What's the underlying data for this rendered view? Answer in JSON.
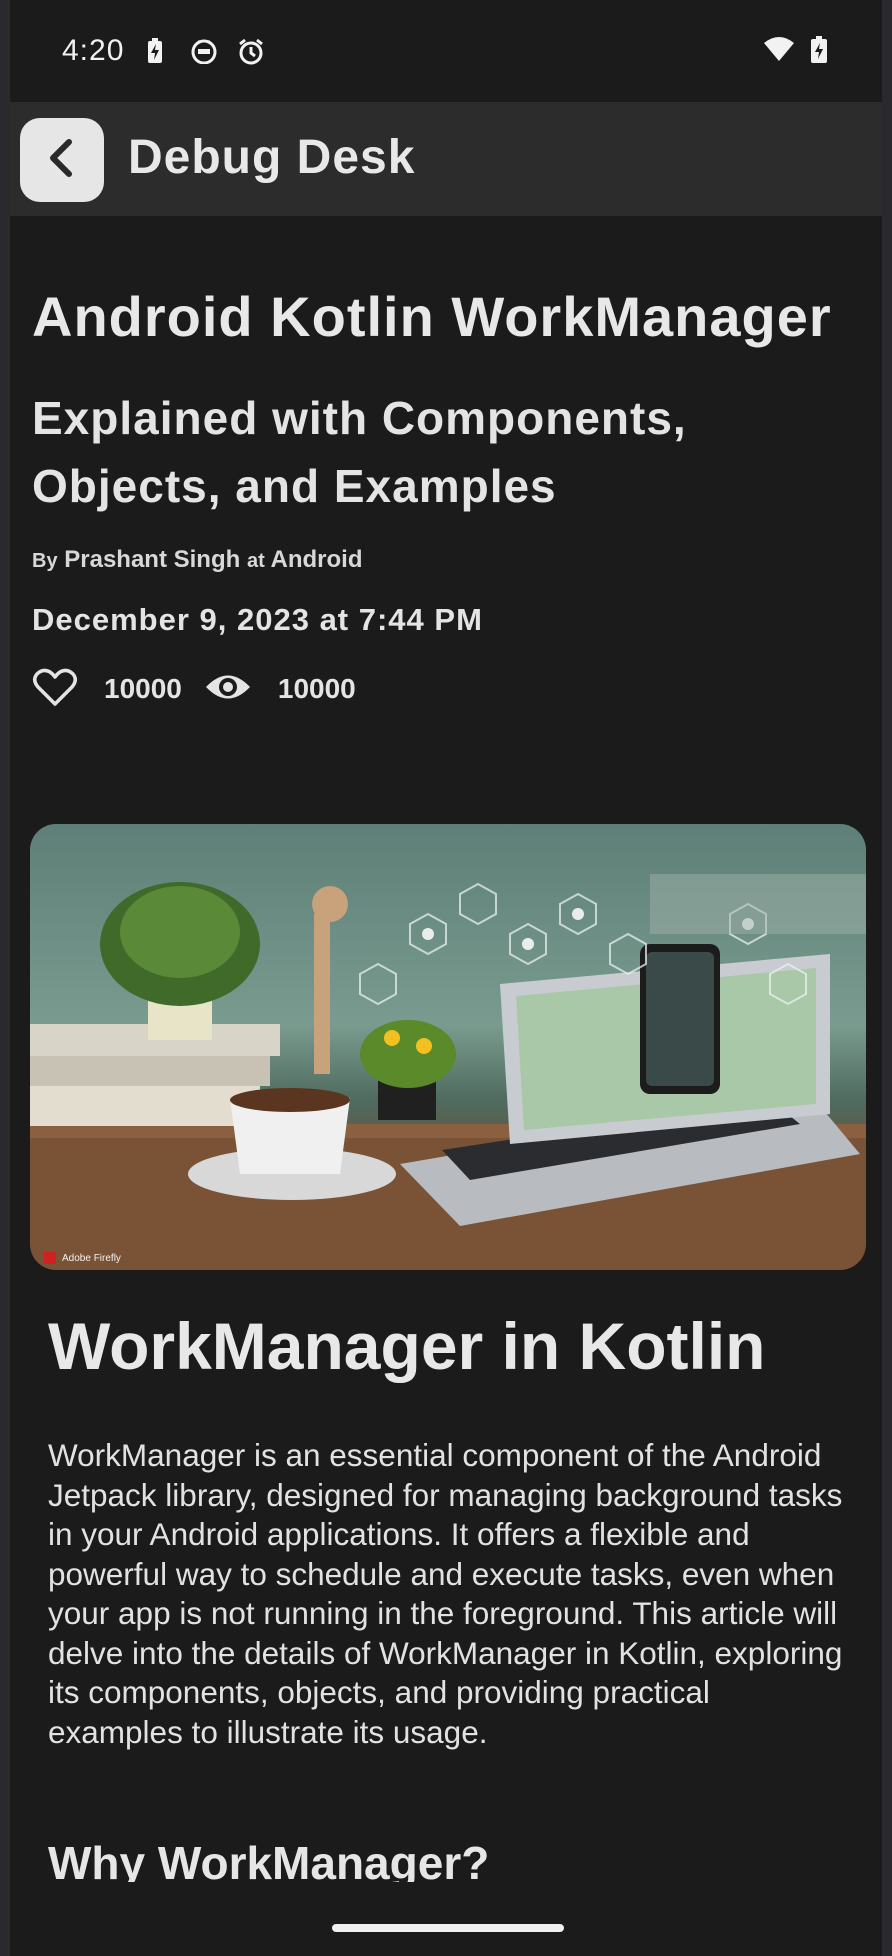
{
  "status_bar": {
    "time": "4:20",
    "icons_left": [
      "battery-charging-icon",
      "notification-face-icon",
      "alarm-icon"
    ],
    "icons_right": [
      "wifi-icon",
      "battery-icon"
    ]
  },
  "top_bar": {
    "back_icon": "chevron-left-icon",
    "title": "Debug Desk"
  },
  "article": {
    "title": "Android Kotlin WorkManager",
    "subtitle": "Explained with Components, Objects, and Examples",
    "byline_prefix": "By",
    "author": "Prashant Singh",
    "byline_at": "at",
    "category": "Android",
    "date": "December 9, 2023 at 7:44 PM",
    "likes_icon": "heart-icon",
    "likes": "10000",
    "views_icon": "eye-icon",
    "views": "10000",
    "hero_caption": "Adobe Firefly"
  },
  "body": {
    "heading": "WorkManager in Kotlin",
    "paragraph": "WorkManager is an essential component of the Android Jetpack library, designed for managing background tasks in your Android applications. It offers a flexible and powerful way to schedule and execute tasks, even when your app is not running in the foreground. This article will delve into the details of WorkManager in Kotlin, exploring its components, objects, and providing practical examples to illustrate its usage.",
    "subheading": "Why WorkManager?"
  },
  "colors": {
    "background": "#1b1b1b",
    "top_bar": "#2c2c2c",
    "text": "#e6e6e6"
  }
}
